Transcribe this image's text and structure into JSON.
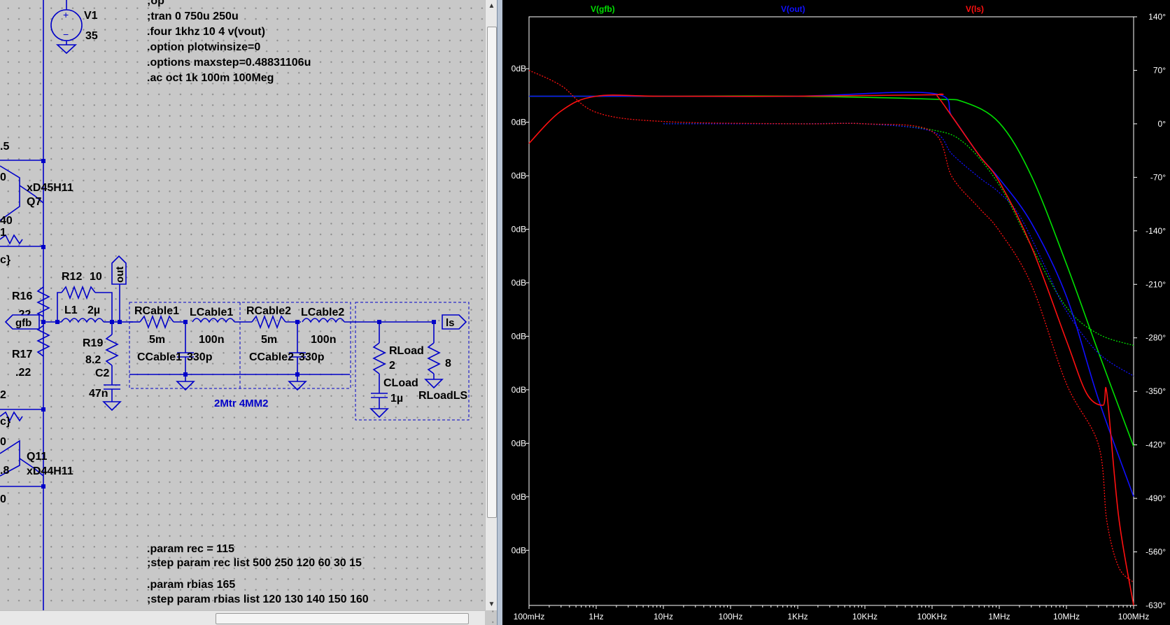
{
  "schematic": {
    "directives_top": [
      ";op",
      ";tran 0 750u 250u",
      ".four 1khz 10 4 v(vout)",
      ".option plotwinsize=0",
      ".options maxstep=0.48831106u",
      ".ac oct 1k 100m 100Meg"
    ],
    "directives_bottom": [
      ".param rec = 115",
      ";step param rec list 500 250 120 60 30 15",
      ".param rbias 165",
      ";step param rbias list 120 130 140 150 160"
    ],
    "source": {
      "name": "V1",
      "value": "35"
    },
    "edge_labels": [
      ".5",
      "0",
      "40",
      "1",
      "c}",
      "2",
      "c}",
      "0",
      ".8",
      "0"
    ],
    "transistors": [
      {
        "model": "xD45H11",
        "name": "Q7"
      },
      {
        "name": "Q11",
        "model": "xD44H11"
      }
    ],
    "components": {
      "R16": {
        "name": "R16",
        "value": ".22"
      },
      "R17": {
        "name": "R17",
        "value": ".22"
      },
      "R12": {
        "name": "R12",
        "value": "10"
      },
      "L1": {
        "name": "L1",
        "value": "2µ"
      },
      "R19": {
        "name": "R19",
        "value": "8.2"
      },
      "C2": {
        "name": "C2",
        "value": "47n"
      },
      "RCable1": {
        "name": "RCable1",
        "value": "5m"
      },
      "LCable1": {
        "name": "LCable1",
        "value": "100n"
      },
      "CCable1": {
        "name": "CCable1",
        "value": "330p"
      },
      "RCable2": {
        "name": "RCable2",
        "value": "5m"
      },
      "LCable2": {
        "name": "LCable2",
        "value": "100n"
      },
      "CCable2": {
        "name": "CCable2",
        "value": "330p"
      },
      "RLoad": {
        "name": "RLoad",
        "value": "2"
      },
      "CLoad": {
        "name": "CLoad",
        "value": "1µ"
      },
      "RLoadLS": {
        "name": "RLoadLS",
        "value": "8"
      }
    },
    "net_labels": {
      "gfb": "gfb",
      "out": "out",
      "ls": "ls"
    },
    "cable_block_label": "2Mtr 4MM2"
  },
  "colors": {
    "gfb": "#00e000",
    "out": "#1010ff",
    "ls": "#ff1010",
    "wire": "#0000c8",
    "plot_bg": "#000000"
  },
  "chart_data": {
    "type": "line",
    "xscale": "log",
    "xlim": [
      0.1,
      100000000
    ],
    "x_ticks": [
      "100mHz",
      "1Hz",
      "10Hz",
      "100Hz",
      "1KHz",
      "10KHz",
      "100KHz",
      "1MHz",
      "10MHz",
      "100MHz"
    ],
    "y_left_ticks": [
      "0dB",
      "0dB",
      "0dB",
      "0dB",
      "0dB",
      "0dB",
      "0dB",
      "0dB",
      "0dB",
      "0dB"
    ],
    "y_right_ticks": [
      "140°",
      "70°",
      "0°",
      "-70°",
      "-140°",
      "-210°",
      "-280°",
      "-350°",
      "-420°",
      "-490°",
      "-560°",
      "-630°"
    ],
    "y_right_range_deg": [
      -630,
      140
    ],
    "series": [
      {
        "name": "V(gfb)",
        "color": "#00e000",
        "mag_x": [
          0.1,
          1,
          10,
          1000,
          100000,
          300000,
          1000000,
          3000000,
          10000000,
          30000000,
          100000000
        ],
        "mag": [
          0.73,
          0.73,
          0.73,
          0.73,
          0.72,
          0.71,
          0.64,
          0.46,
          0.16,
          -0.14,
          -0.46
        ],
        "phase_x": [
          10,
          1000,
          10000,
          100000,
          300000,
          1000000,
          3000000,
          10000000,
          30000000,
          100000000
        ],
        "phase": [
          0,
          0,
          0,
          -8,
          -25,
          -80,
          -160,
          -240,
          -275,
          -290
        ]
      },
      {
        "name": "V(out)",
        "color": "#1010ff",
        "mag_x": [
          0.1,
          1,
          10,
          1000,
          100000,
          200000,
          500000,
          1000000,
          3000000,
          10000000,
          30000000,
          100000000
        ],
        "mag": [
          0.73,
          0.73,
          0.73,
          0.73,
          0.74,
          0.66,
          0.53,
          0.45,
          0.3,
          0.05,
          -0.3,
          -0.63
        ],
        "phase_x": [
          10,
          1000,
          10000,
          100000,
          200000,
          500000,
          1000000,
          2000000,
          5000000,
          10000000,
          30000000,
          100000000
        ],
        "phase": [
          0,
          0,
          0,
          -10,
          -40,
          -70,
          -90,
          -120,
          -190,
          -245,
          -300,
          -330
        ]
      },
      {
        "name": "V(ls)",
        "color": "#ff1010",
        "mag_x": [
          0.1,
          0.3,
          1,
          10,
          1000,
          100000,
          120000,
          200000,
          500000,
          1000000,
          3000000,
          10000000,
          20000000,
          35000000,
          40000000,
          60000000,
          100000000
        ],
        "mag": [
          0.57,
          0.68,
          0.73,
          0.73,
          0.73,
          0.735,
          0.73,
          0.66,
          0.53,
          0.44,
          0.22,
          -0.1,
          -0.28,
          -0.32,
          -0.28,
          -0.7,
          -1.0
        ],
        "phase_x": [
          0.1,
          0.3,
          1,
          10,
          1000,
          10000,
          100000,
          200000,
          500000,
          1000000,
          3000000,
          10000000,
          30000000,
          40000000,
          60000000,
          100000000
        ],
        "phase": [
          70,
          50,
          15,
          3,
          0,
          0,
          -10,
          -70,
          -110,
          -140,
          -210,
          -340,
          -420,
          -520,
          -580,
          -600
        ]
      }
    ]
  }
}
